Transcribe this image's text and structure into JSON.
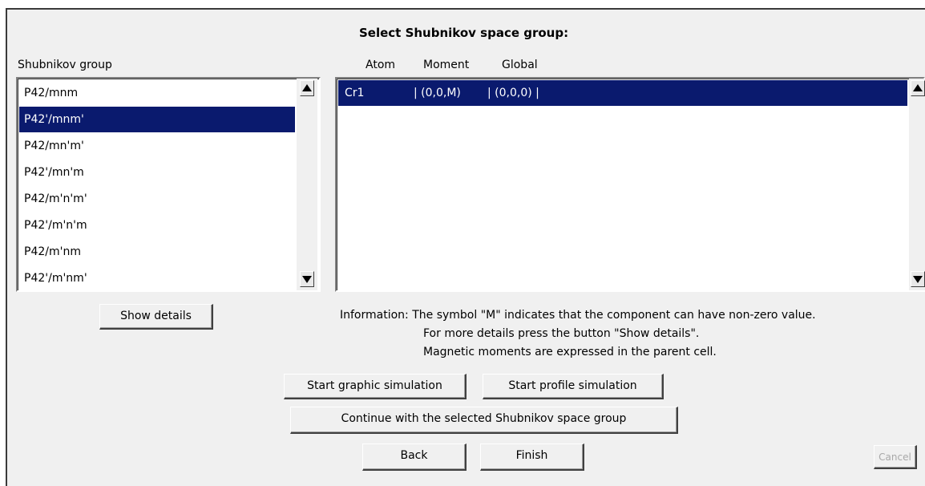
{
  "dialog": {
    "title": "Select Shubnikov space group:"
  },
  "groups_panel": {
    "header": "Shubnikov  group",
    "items": [
      "P42/mnm",
      "P42'/mnm'",
      "P42/mn'm'",
      "P42'/mn'm",
      "P42/m'n'm'",
      "P42'/m'n'm",
      "P42/m'nm",
      "P42'/m'nm'"
    ],
    "selected_index": 1
  },
  "moments_panel": {
    "headers": {
      "atom": "Atom",
      "moment": "Moment",
      "global": "Global"
    },
    "rows": [
      {
        "atom": "Cr1",
        "moment": "| (0,0,M)",
        "global": "| (0,0,0)  |"
      }
    ],
    "selected_index": 0
  },
  "buttons": {
    "show_details": "Show details",
    "start_graphic": "Start graphic simulation",
    "start_profile": "Start profile simulation",
    "continue": "Continue with the selected Shubnikov space group",
    "back": "Back",
    "finish": "Finish",
    "cancel": "Cancel"
  },
  "information": {
    "line1": "Information: The symbol \"M\" indicates that the component can have non-zero value.",
    "line2": "For more details press the button \"Show details\".",
    "line3": "Magnetic moments are expressed in the parent cell."
  },
  "colors": {
    "selection": "#0a1a6e",
    "window_bg": "#f0f0f0"
  }
}
